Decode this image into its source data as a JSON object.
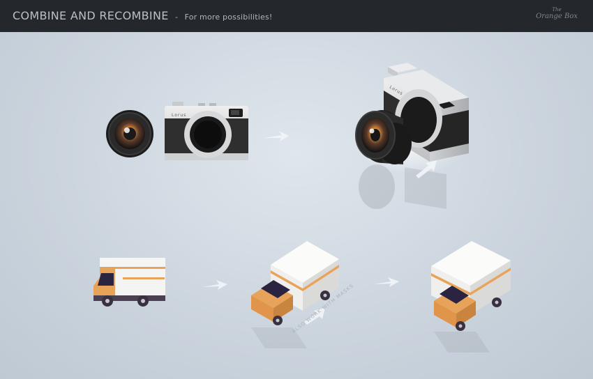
{
  "header": {
    "title": "COMBINE AND RECOMBINE",
    "separator": "-",
    "subtitle": "For more possibilities!",
    "brand_line1": "The",
    "brand_line2": "Orange Box"
  },
  "camera": {
    "brand": "Lorus"
  },
  "truck_note": "ALSO WORK WITH MASKS",
  "colors": {
    "header_bg": "#24272b",
    "background": "#c9d3dd",
    "truck_orange": "#e8a35a",
    "truck_body": "#f4f4f2",
    "camera_leather": "#2d2d2d",
    "camera_silver": "#d9dadb"
  }
}
